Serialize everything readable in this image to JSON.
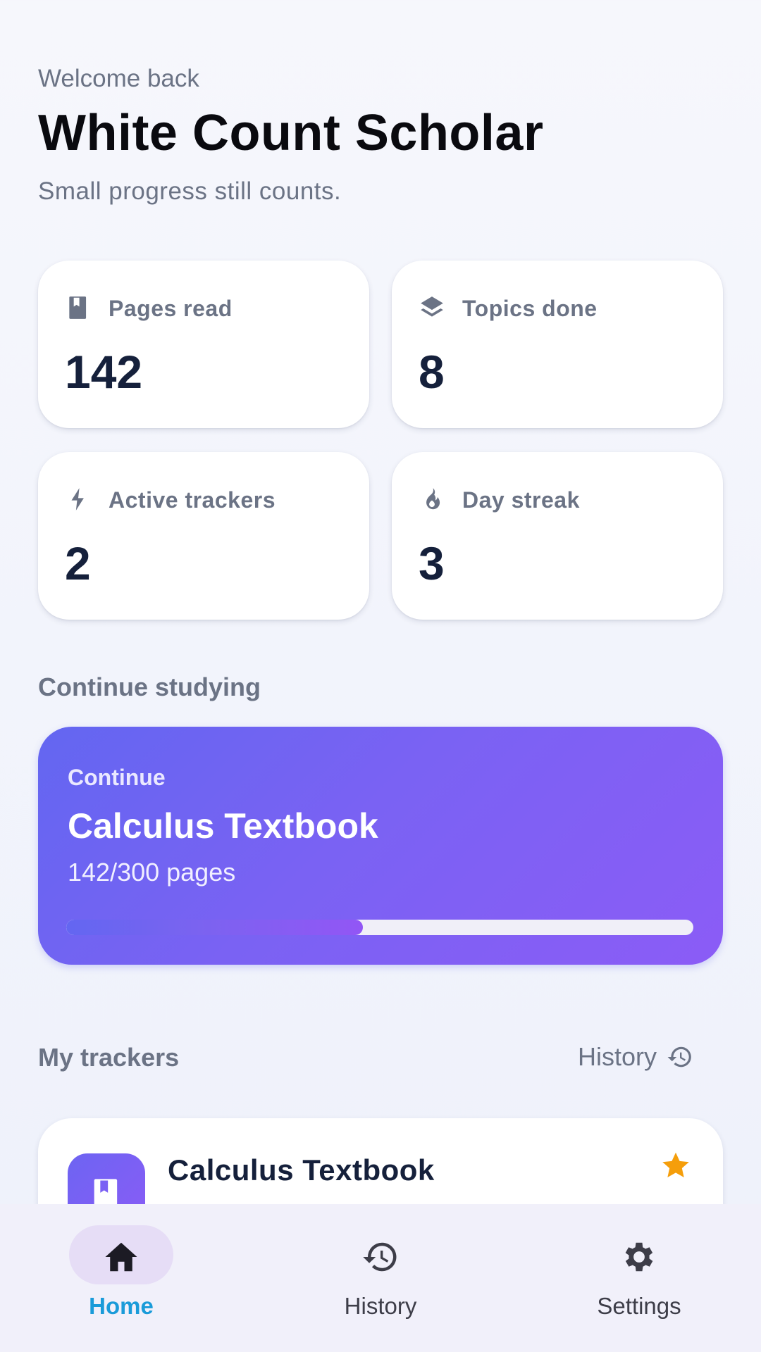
{
  "header": {
    "welcome": "Welcome back",
    "name": "White Count Scholar",
    "tagline": "Small progress still counts."
  },
  "stats": [
    {
      "label": "Pages read",
      "value": "142",
      "icon": "book-icon"
    },
    {
      "label": "Topics done",
      "value": "8",
      "icon": "layers-icon"
    },
    {
      "label": "Active trackers",
      "value": "2",
      "icon": "bolt-icon"
    },
    {
      "label": "Day streak",
      "value": "3",
      "icon": "flame-icon"
    }
  ],
  "continue_section": {
    "title": "Continue studying",
    "card": {
      "label": "Continue",
      "title": "Calculus Textbook",
      "progress_text": "142/300 pages",
      "progress_fraction": 0.4733
    }
  },
  "trackers_section": {
    "title": "My trackers",
    "history_label": "History",
    "items": [
      {
        "title": "Calculus Textbook",
        "favorite": true,
        "icon": "book-icon"
      }
    ]
  },
  "bottom_nav": [
    {
      "label": "Home",
      "icon": "home-icon",
      "active": true
    },
    {
      "label": "History",
      "icon": "history-icon",
      "active": false
    },
    {
      "label": "Settings",
      "icon": "gear-icon",
      "active": false
    }
  ],
  "colors": {
    "accent_start": "#6366f1",
    "accent_end": "#8b5cf6",
    "nav_active": "#1a9bd9",
    "star": "#f59e0b"
  }
}
